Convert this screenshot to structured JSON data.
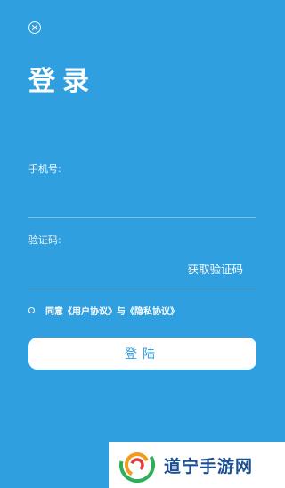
{
  "header": {
    "title": "登录"
  },
  "form": {
    "phone_label": "手机号:",
    "phone_value": "",
    "code_label": "验证码:",
    "code_value": "",
    "get_code_label": "获取验证码"
  },
  "agreement": {
    "text": "同意《用户协议》与《隐私协议》"
  },
  "actions": {
    "login_label": "登陆"
  },
  "watermark": {
    "text": "道宁手游网"
  },
  "colors": {
    "background": "#2f9fdf",
    "button_text": "#2f9fdf",
    "watermark_text": "#1c4f91"
  },
  "icons": [
    "close-icon",
    "agree-radio-icon",
    "watermark-logo-icon"
  ]
}
